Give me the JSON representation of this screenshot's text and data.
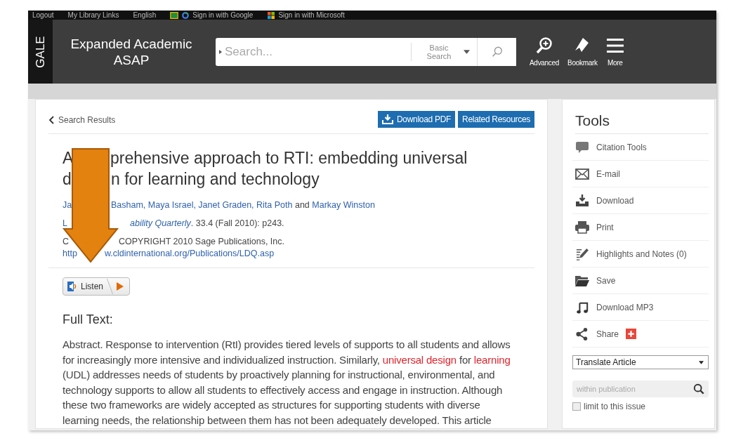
{
  "top_links": [
    {
      "kind": "plain",
      "label": "Logout"
    },
    {
      "kind": "plain",
      "label": "My Library Links"
    },
    {
      "kind": "plain",
      "label": "English"
    },
    {
      "kind": "google",
      "label": "Sign in with Google"
    },
    {
      "kind": "microsoft",
      "label": "Sign in with Microsoft"
    }
  ],
  "header": {
    "logo": "GALE",
    "product": "Expanded Academic ASAP",
    "search": {
      "placeholder": "Search...",
      "mode": "Basic Search"
    },
    "actions": [
      {
        "kind": "advanced",
        "label": "Advanced"
      },
      {
        "kind": "bookmark",
        "label": "Bookmark"
      },
      {
        "kind": "more",
        "label": "More"
      }
    ]
  },
  "article": {
    "back_link": "Search Results",
    "buttons": [
      {
        "kind": "download",
        "label": "Download PDF"
      },
      {
        "kind": "plain",
        "label": "Related Resources"
      }
    ],
    "title_lines": [
      {
        "left": "A",
        "right": "prehensive approach to RTI: embedding universal"
      },
      {
        "left": "d",
        "right": "n for learning and technology"
      }
    ],
    "meta_lines": [
      {
        "left": [
          {
            "kind": "link",
            "text": "Ja"
          }
        ],
        "right": [
          {
            "kind": "link",
            "text": "Basham, Maya Israel, Janet Graden, Rita Poth"
          },
          {
            "kind": "text",
            "text": " and "
          },
          {
            "kind": "link",
            "text": "Markay Winston"
          }
        ]
      },
      {
        "left": [
          {
            "kind": "journal",
            "text": "L"
          }
        ],
        "right": [
          {
            "kind": "journal",
            "text": "ability Quarterly"
          },
          {
            "kind": "text",
            "text": ". 33.4 (Fall 2010): p243."
          }
        ]
      },
      {
        "left": [
          {
            "kind": "text",
            "text": "C"
          }
        ],
        "right": [
          {
            "kind": "text",
            "text": "COPYRIGHT 2010 Sage Publications, Inc."
          }
        ]
      },
      {
        "left": [
          {
            "kind": "link",
            "text": "http"
          }
        ],
        "right": [
          {
            "kind": "link",
            "text": "w.cldinternational.org/Publications/LDQ.asp"
          }
        ]
      }
    ],
    "listen": "Listen",
    "full_text_heading": "Full Text:",
    "paragraph_lines": [
      [
        {
          "highlight": false,
          "text": "Abstract. Response to intervention (RtI) provides tiered levels of supports to all students and allows"
        }
      ],
      [
        {
          "highlight": false,
          "text": "for increasingly more intensive and individualized instruction. Similarly, "
        },
        {
          "highlight": true,
          "text": "universal design"
        },
        {
          "highlight": false,
          "text": " for "
        },
        {
          "highlight": true,
          "text": "learning"
        }
      ],
      [
        {
          "highlight": false,
          "text": "(UDL) addresses needs of students by proactively planning for instructional, environmental, and"
        }
      ],
      [
        {
          "highlight": false,
          "text": "technology supports to allow all students to effectively access and engage in instruction. Although"
        }
      ],
      [
        {
          "highlight": false,
          "text": "these two frameworks are widely accepted as structures for supporting students with diverse"
        }
      ],
      [
        {
          "highlight": false,
          "text": "learning needs, the relationship between them has not been adequately developed. This article"
        }
      ]
    ]
  },
  "tools": {
    "title": "Tools",
    "items": [
      {
        "kind": "citation",
        "label": "Citation Tools"
      },
      {
        "kind": "email",
        "label": "E-mail"
      },
      {
        "kind": "download",
        "label": "Download"
      },
      {
        "kind": "print",
        "label": "Print"
      },
      {
        "kind": "notes",
        "label": "Highlights and Notes (0)"
      },
      {
        "kind": "save",
        "label": "Save"
      },
      {
        "kind": "mp3",
        "label": "Download MP3"
      },
      {
        "kind": "share",
        "label": "Share"
      }
    ],
    "translate": "Translate Article",
    "search": {
      "placeholder": "within publication"
    },
    "limit": {
      "label": "limit to this issue",
      "checked": false
    }
  }
}
